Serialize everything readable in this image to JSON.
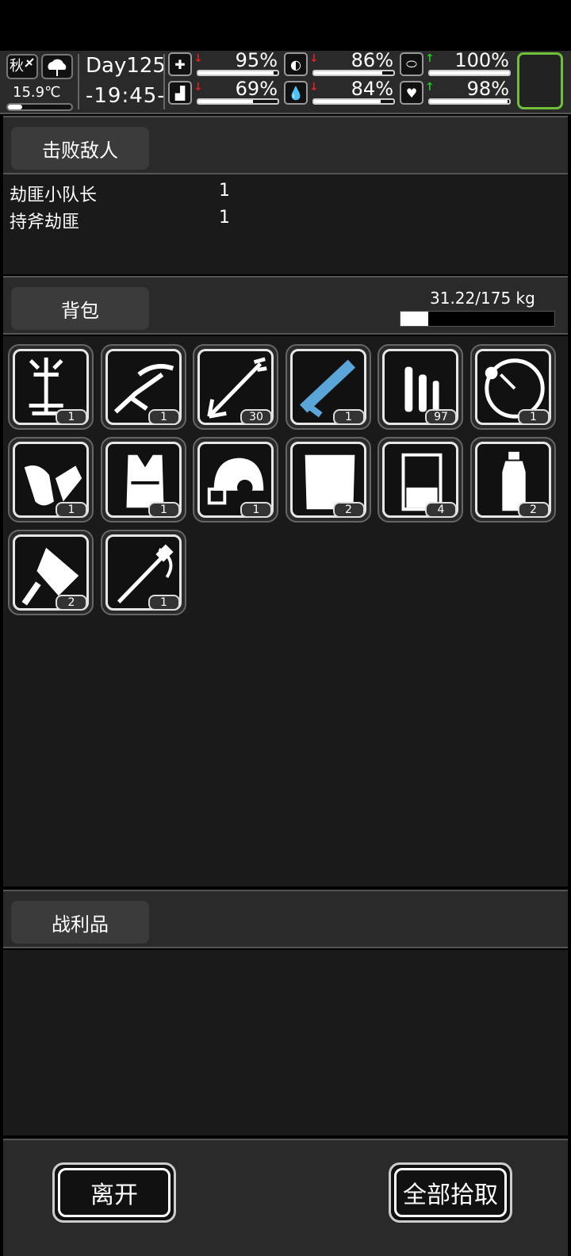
{
  "status": {
    "season": "秋",
    "temperature": "15.9℃",
    "day": "Day125",
    "time": "-19:45-",
    "stats": [
      {
        "name": "health",
        "icon": "medkit-icon",
        "trend": "down",
        "value": "95%",
        "fill": 0.95
      },
      {
        "name": "hunger",
        "icon": "stomach-icon",
        "trend": "down",
        "value": "86%",
        "fill": 0.86
      },
      {
        "name": "mood",
        "icon": "pill-icon",
        "trend": "up",
        "value": "100%",
        "fill": 1.0
      },
      {
        "name": "stamina",
        "icon": "boot-icon",
        "trend": "down",
        "value": "69%",
        "fill": 0.69
      },
      {
        "name": "thirst",
        "icon": "water-drop-icon",
        "trend": "down",
        "value": "84%",
        "fill": 0.84
      },
      {
        "name": "heart",
        "icon": "heart-icon",
        "trend": "up",
        "value": "98%",
        "fill": 0.98
      }
    ]
  },
  "defeated": {
    "tab": "击败敌人",
    "enemies": [
      {
        "name": "劫匪小队长",
        "count": "1"
      },
      {
        "name": "持斧劫匪",
        "count": "1"
      }
    ]
  },
  "backpack": {
    "tab": "背包",
    "weight": "31.22/175 kg",
    "weight_fill": 0.178,
    "items": [
      {
        "icon": "tool-frame-icon",
        "qty": "1"
      },
      {
        "icon": "crossbow-icon",
        "qty": "1"
      },
      {
        "icon": "arrow-icon",
        "qty": "30"
      },
      {
        "icon": "minigun-icon",
        "qty": "1"
      },
      {
        "icon": "bullets-icon",
        "qty": "97"
      },
      {
        "icon": "gauge-icon",
        "qty": "1"
      },
      {
        "icon": "gloves-icon",
        "qty": "1"
      },
      {
        "icon": "vest-icon",
        "qty": "1"
      },
      {
        "icon": "helmet-icon",
        "qty": "1"
      },
      {
        "icon": "cloth-icon",
        "qty": "2"
      },
      {
        "icon": "beaker-icon",
        "qty": "4"
      },
      {
        "icon": "water-bottle-icon",
        "qty": "2"
      },
      {
        "icon": "cleaver-icon",
        "qty": "2"
      },
      {
        "icon": "saber-icon",
        "qty": "1"
      }
    ]
  },
  "loot": {
    "tab": "战利品"
  },
  "buttons": {
    "leave": "离开",
    "take_all": "全部拾取"
  },
  "colors": {
    "accent_up": "#22c422",
    "accent_down": "#e02020",
    "avatar_border": "#6fbf3a",
    "item_blue": "#5aa6d8"
  }
}
